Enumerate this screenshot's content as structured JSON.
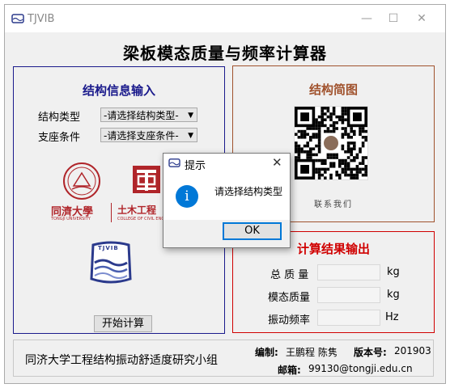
{
  "window": {
    "title": "TJVIB",
    "main_title": "梁板模态质量与频率计算器"
  },
  "input_panel": {
    "title": "结构信息输入",
    "structure_type_label": "结构类型",
    "structure_type_value": "-请选择结构类型-",
    "support_label": "支座条件",
    "support_value": "-请选择支座条件-",
    "logo_tongji_text": "同濟大學",
    "logo_tongji_sub": "TONGJI UNIVERSITY",
    "logo_civil_text": "土木工程",
    "logo_civil_sub": "COLLEGE OF CIVIL ENG",
    "logo_tjvib_text": "TJVIB",
    "start_button": "开始计算"
  },
  "sketch_panel": {
    "title": "结构简图",
    "caption": "联系我们"
  },
  "output_panel": {
    "title": "计算结果输出",
    "total_mass_label": "总 质 量",
    "total_mass_unit": "kg",
    "modal_mass_label": "模态质量",
    "modal_mass_unit": "kg",
    "frequency_label": "振动频率",
    "frequency_unit": "Hz"
  },
  "footer": {
    "group_name": "同济大学工程结构振动舒适度研究小组",
    "editor_label": "编制:",
    "editor_value": "王鹏程 陈隽",
    "version_label": "版本号:",
    "version_value": "201903",
    "email_label": "邮箱:",
    "email_value": "99130@tongji.edu.cn"
  },
  "dialog": {
    "title": "提示",
    "message": "请选择结构类型",
    "ok_button": "OK",
    "icon_glyph": "i"
  },
  "colors": {
    "navy": "#1a1a8c",
    "brown": "#a0522d",
    "red": "#d00000",
    "info_blue": "#0078d7"
  }
}
